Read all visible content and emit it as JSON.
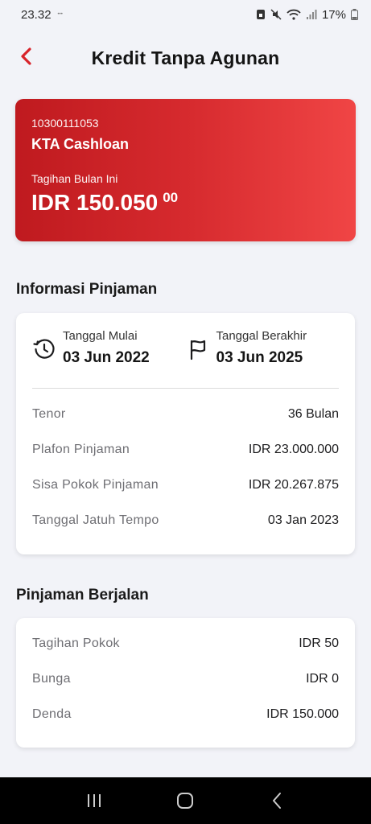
{
  "status_bar": {
    "time": "23.32",
    "small_text": "•••",
    "battery": "17%"
  },
  "header": {
    "title": "Kredit Tanpa Agunan"
  },
  "account": {
    "number": "10300111053",
    "name": "KTA Cashloan",
    "bill_label": "Tagihan Bulan Ini",
    "bill_amount": "IDR 150.050",
    "bill_decimal": "00",
    "gradient_start": "#bf1a1f",
    "gradient_end": "#f04545"
  },
  "loan_info": {
    "section_title": "Informasi Pinjaman",
    "start_label": "Tanggal Mulai",
    "start_value": "03 Jun 2022",
    "end_label": "Tanggal Berakhir",
    "end_value": "03 Jun 2025",
    "rows": [
      {
        "label": "Tenor",
        "value": "36 Bulan"
      },
      {
        "label": "Plafon Pinjaman",
        "value": "IDR 23.000.000"
      },
      {
        "label": "Sisa Pokok Pinjaman",
        "value": "IDR 20.267.875"
      },
      {
        "label": "Tanggal Jatuh Tempo",
        "value": "03 Jan 2023"
      }
    ]
  },
  "running_loan": {
    "section_title": "Pinjaman Berjalan",
    "rows": [
      {
        "label": "Tagihan Pokok",
        "value": "IDR 50"
      },
      {
        "label": "Bunga",
        "value": "IDR 0"
      },
      {
        "label": "Denda",
        "value": "IDR 150.000"
      }
    ]
  },
  "colors": {
    "accent": "#d8232a",
    "background": "#f2f3f8"
  }
}
